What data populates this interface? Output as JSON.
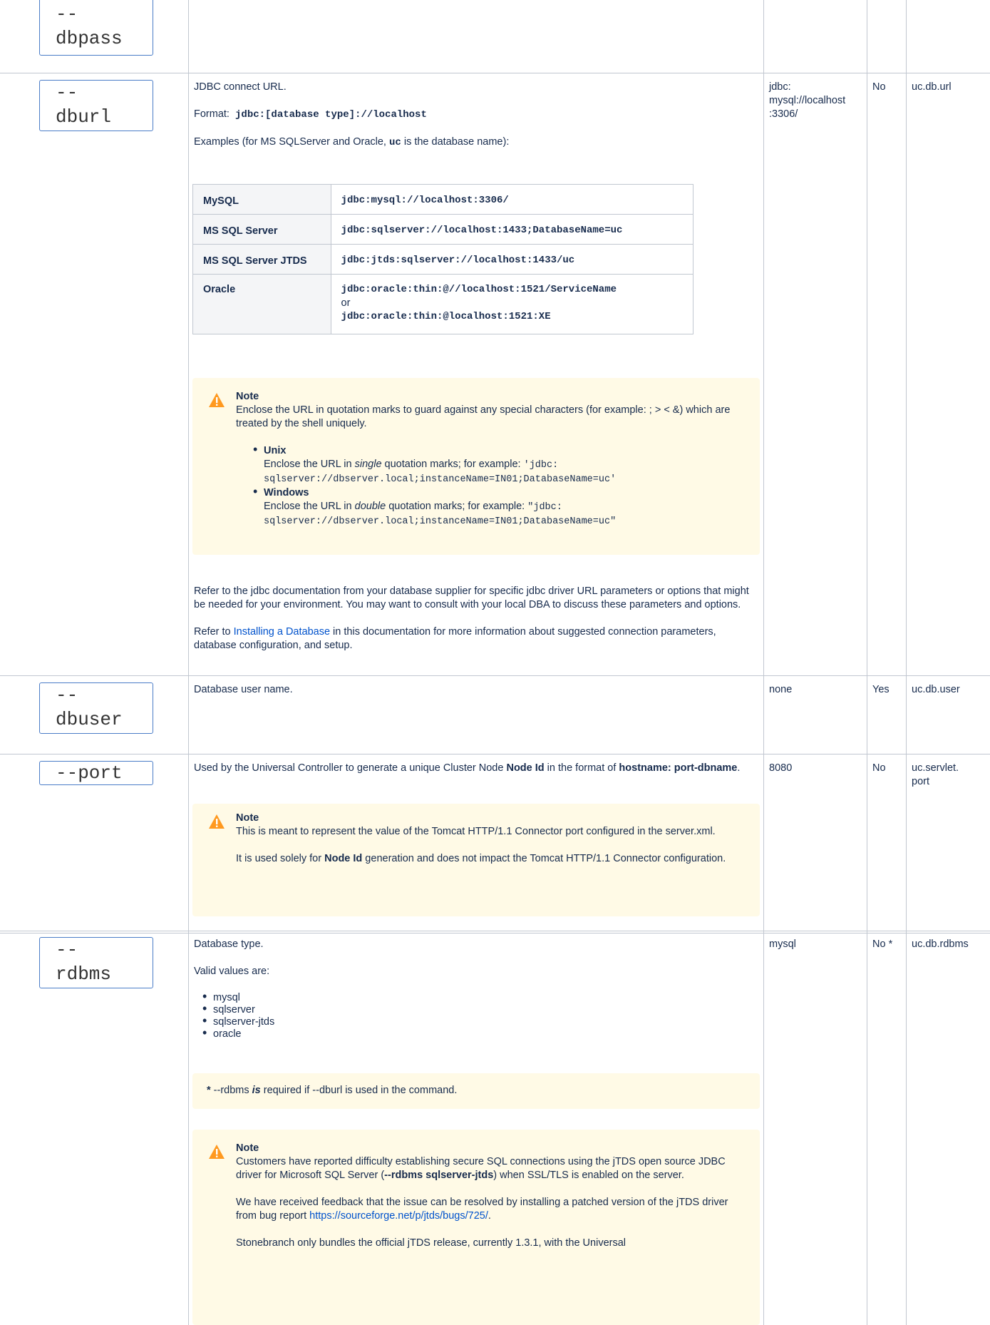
{
  "rows": {
    "dbpass": {
      "param": "--\ndbpass"
    },
    "dburl": {
      "param": "--\ndburl",
      "desc": "JDBC connect URL.",
      "format_label": "Format:",
      "format_value": "jdbc:[database type]://localhost",
      "examples_intro": "Examples (for MS SQLServer and Oracle, ",
      "examples_uc": "uc",
      "examples_rest": " is the database name):",
      "table": [
        {
          "db": "MySQL",
          "url": "jdbc:mysql://localhost:3306/"
        },
        {
          "db": "MS SQL Server",
          "url": "jdbc:sqlserver://localhost:1433;DatabaseName=uc"
        },
        {
          "db": "MS SQL Server JTDS",
          "url": "jdbc:jtds:sqlserver://localhost:1433/uc"
        },
        {
          "db": "Oracle",
          "url": "jdbc:oracle:thin:@//localhost:1521/ServiceName",
          "or": "or",
          "url2": "jdbc:oracle:thin:@localhost:1521:XE"
        }
      ],
      "note": {
        "title": "Note",
        "text": "Enclose the URL in quotation marks to guard against any special characters (for example: ; > < &) which are treated by the shell uniquely.",
        "unix_title": "Unix",
        "unix_pre": "Enclose the URL in ",
        "unix_em": "single",
        "unix_post": " quotation marks; for example: ",
        "unix_code1": "'jdbc:",
        "unix_code2": "sqlserver://dbserver.local;instanceName=IN01;DatabaseName=uc'",
        "win_title": "Windows",
        "win_pre": "Enclose the URL in ",
        "win_em": "double",
        "win_post": " quotation marks; for example: ",
        "win_code1": "\"jdbc:",
        "win_code2": "sqlserver://dbserver.local;instanceName=IN01;DatabaseName=uc\""
      },
      "refer1": "Refer to the jdbc documentation from your database supplier for specific jdbc driver URL parameters or options that might be needed for your environment. You may want to consult with your local DBA to discuss these parameters and options.",
      "refer2_pre": "Refer to ",
      "refer2_link": "Installing a Database",
      "refer2_post": " in this documentation for more information about suggested connection parameters, database configuration, and setup.",
      "default": "jdbc:\nmysql://localhost\n:3306/",
      "required": "No",
      "property": "uc.db.url"
    },
    "dbuser": {
      "param": "--\ndbuser",
      "desc": "Database user name.",
      "default": "none",
      "required": "Yes",
      "property": "uc.db.user"
    },
    "port": {
      "param": "--port",
      "desc_pre": "Used by the Universal Controller to generate a unique Cluster Node ",
      "desc_b1": "Node Id",
      "desc_mid": " in the format of ",
      "desc_b2": "hostname: port-dbname",
      "desc_post": ".",
      "note_title": "Note",
      "note_p1": "This is meant to represent the value of the Tomcat HTTP/1.1 Connector port configured in the server.xml.",
      "note_p2_pre": "It is used solely for ",
      "note_p2_b": "Node Id",
      "note_p2_post": " generation and does not impact the Tomcat HTTP/1.1 Connector configuration.",
      "default": "8080",
      "required": "No",
      "property": "uc.servlet.\nport"
    },
    "rdbms": {
      "param": "--\nrdbms",
      "desc": "Database type.",
      "valid": "Valid values are:",
      "values": [
        "mysql",
        "sqlserver",
        "sqlserver-jtds",
        "oracle"
      ],
      "star_pre": "* ",
      "star_text": "--rdbms ",
      "star_em": "is",
      "star_post": " required if --dburl is used in the command.",
      "note_title": "Note",
      "note_p1_pre": "Customers have reported difficulty establishing secure SQL connections using the jTDS open source JDBC driver for Microsoft SQL Server (",
      "note_p1_b": "--rdbms sqlserver-jtds",
      "note_p1_post": ") when SSL/TLS is enabled on the server.",
      "note_p2_pre": "We have received feedback that the issue can be resolved by installing a patched version of the jTDS driver from bug report ",
      "note_p2_link": "https://sourceforge.net/p/jtds/bugs/725/",
      "note_p2_post": ".",
      "note_p3": "Stonebranch only bundles the official jTDS release, currently 1.3.1, with the Universal",
      "default": "mysql",
      "required": "No *",
      "property": "uc.db.rdbms"
    }
  }
}
